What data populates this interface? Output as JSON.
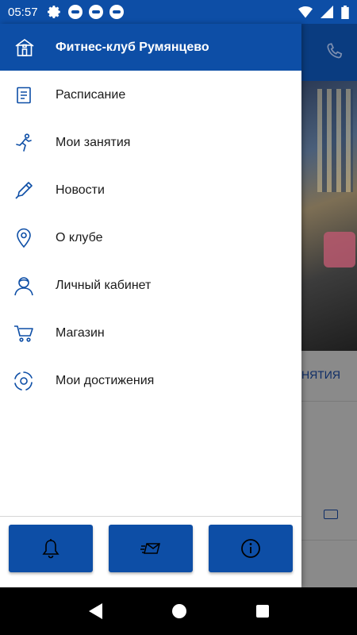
{
  "status_bar": {
    "time": "05:57",
    "icons": [
      "gear-icon",
      "app-icon",
      "app-icon",
      "app-icon"
    ],
    "right_icons": [
      "wifi-icon",
      "signal-icon",
      "battery-icon"
    ]
  },
  "drawer": {
    "title": "Фитнес-клуб Румянцево",
    "header_icon": "building-icon",
    "items": [
      {
        "label": "Расписание",
        "icon": "document-icon"
      },
      {
        "label": "Мои занятия",
        "icon": "runner-icon"
      },
      {
        "label": "Новости",
        "icon": "pen-icon"
      },
      {
        "label": "О клубе",
        "icon": "location-pin-icon"
      },
      {
        "label": "Личный кабинет",
        "icon": "user-icon"
      },
      {
        "label": "Магазин",
        "icon": "cart-icon"
      },
      {
        "label": "Мои достижения",
        "icon": "achievements-icon"
      }
    ],
    "footer_buttons": [
      {
        "icon": "bell-icon"
      },
      {
        "icon": "mail-icon"
      },
      {
        "icon": "info-icon"
      }
    ]
  },
  "background": {
    "tab_label": "НЯТИЯ",
    "icons": [
      "phone-icon",
      "money-icon"
    ]
  },
  "colors": {
    "primary": "#0d4ea6",
    "icon": "#0d4ea6",
    "text": "#1a1a1a"
  }
}
